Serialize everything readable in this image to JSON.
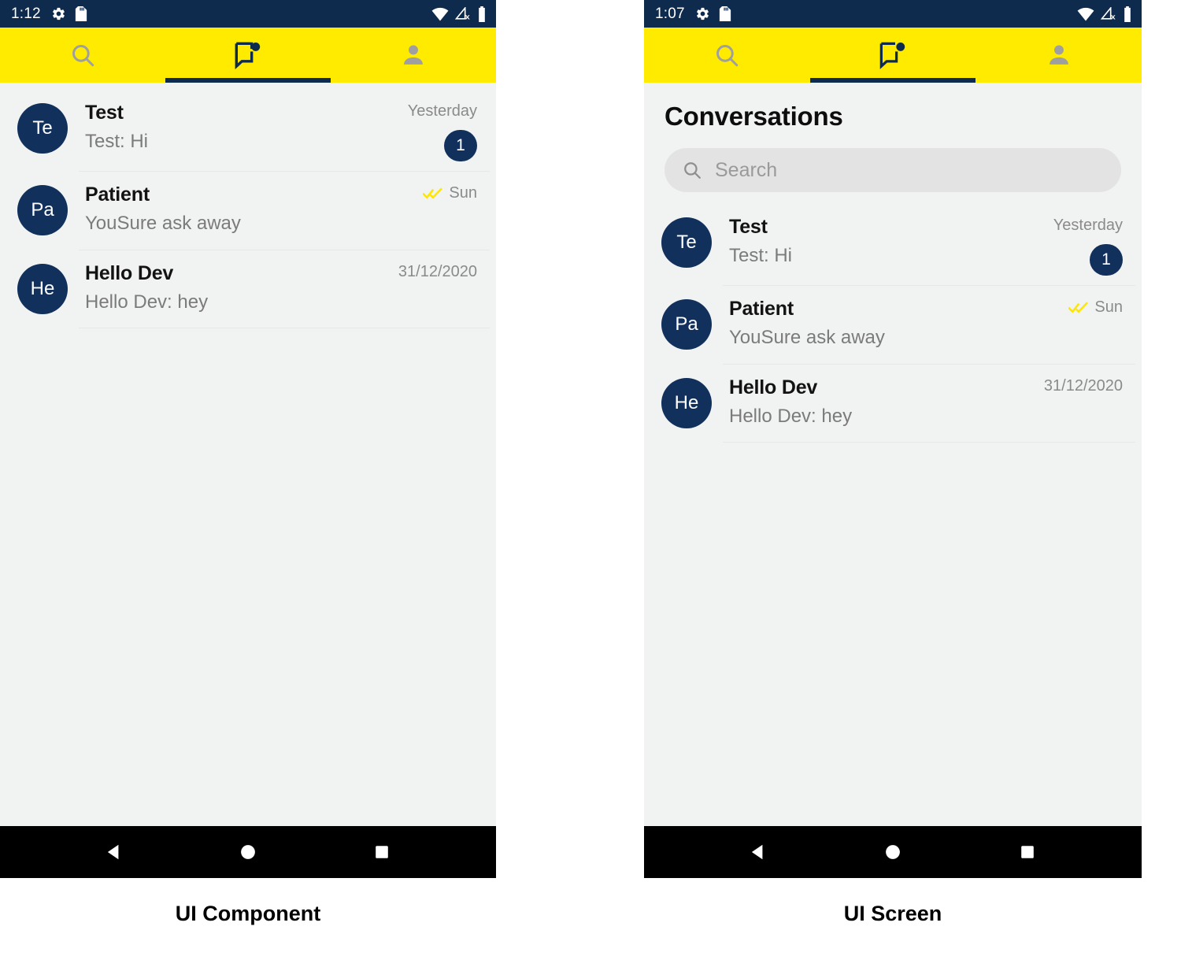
{
  "colors": {
    "status_bar": "#0e2a4d",
    "accent_yellow": "#ffeb00",
    "navy": "#11305c",
    "background": "#f1f2f2",
    "search_field": "#e3e3e3",
    "read_receipt_yellow": "#ffe600"
  },
  "panels": [
    {
      "caption": "UI Component",
      "status_bar": {
        "time": "1:12",
        "left_icons": [
          "gear-icon",
          "sd-card-icon"
        ],
        "right_icons": [
          "wifi-icon",
          "cellular-off-icon",
          "battery-icon"
        ]
      },
      "tabs": [
        {
          "icon": "search-icon",
          "active": false
        },
        {
          "icon": "chat-bubble-badge-icon",
          "active": true
        },
        {
          "icon": "person-icon",
          "active": false
        }
      ],
      "show_title": false,
      "show_search": false,
      "title": "",
      "search": {
        "placeholder": ""
      },
      "conversations": [
        {
          "initials": "Te",
          "name": "Test",
          "snippet": "Test: Hi",
          "time": "Yesterday",
          "unread": "1",
          "read_receipt": false
        },
        {
          "initials": "Pa",
          "name": "Patient",
          "snippet": "YouSure ask away",
          "time": "Sun",
          "unread": "",
          "read_receipt": true
        },
        {
          "initials": "He",
          "name": "Hello Dev",
          "snippet": "Hello Dev: hey",
          "time": "31/12/2020",
          "unread": "",
          "read_receipt": false
        }
      ],
      "nav_bar": [
        "back-triangle-icon",
        "home-circle-icon",
        "recents-square-icon"
      ]
    },
    {
      "caption": "UI Screen",
      "status_bar": {
        "time": "1:07",
        "left_icons": [
          "gear-icon",
          "sd-card-icon"
        ],
        "right_icons": [
          "wifi-icon",
          "cellular-off-icon",
          "battery-icon"
        ]
      },
      "tabs": [
        {
          "icon": "search-icon",
          "active": false
        },
        {
          "icon": "chat-bubble-badge-icon",
          "active": true
        },
        {
          "icon": "person-icon",
          "active": false
        }
      ],
      "show_title": true,
      "show_search": true,
      "title": "Conversations",
      "search": {
        "placeholder": "Search",
        "value": ""
      },
      "conversations": [
        {
          "initials": "Te",
          "name": "Test",
          "snippet": "Test: Hi",
          "time": "Yesterday",
          "unread": "1",
          "read_receipt": false
        },
        {
          "initials": "Pa",
          "name": "Patient",
          "snippet": "YouSure ask away",
          "time": "Sun",
          "unread": "",
          "read_receipt": true
        },
        {
          "initials": "He",
          "name": "Hello Dev",
          "snippet": "Hello Dev: hey",
          "time": "31/12/2020",
          "unread": "",
          "read_receipt": false
        }
      ],
      "nav_bar": [
        "back-triangle-icon",
        "home-circle-icon",
        "recents-square-icon"
      ]
    }
  ]
}
